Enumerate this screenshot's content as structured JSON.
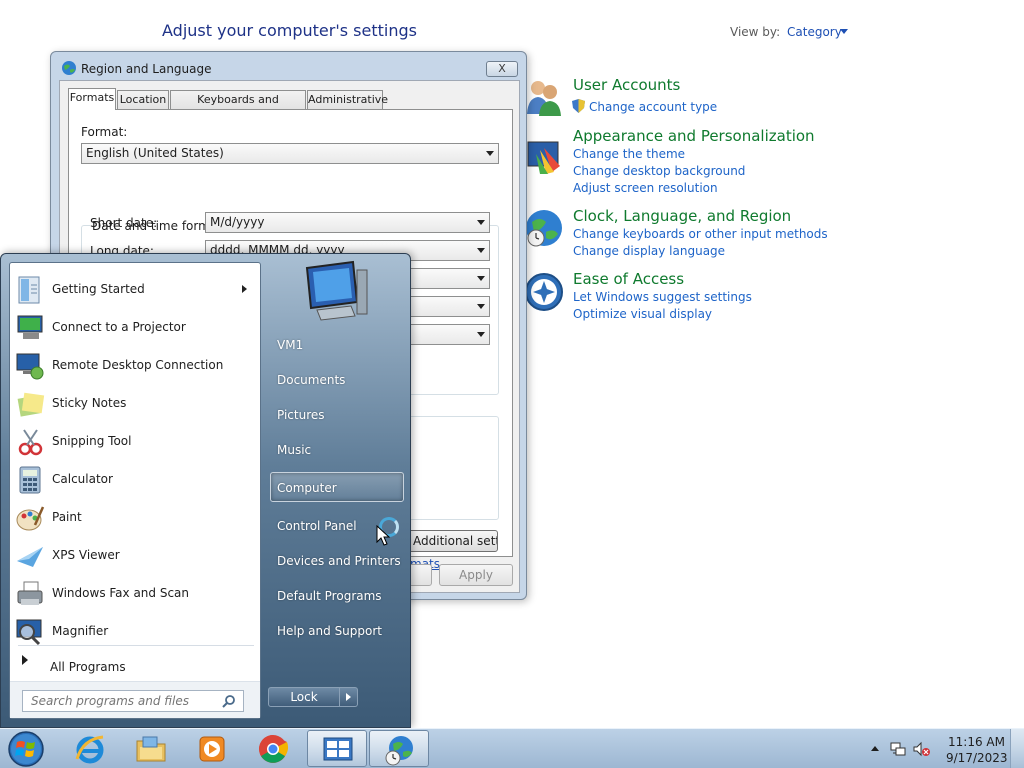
{
  "control_panel": {
    "heading": "Adjust your computer's settings",
    "view_by_label": "View by:",
    "view_by_value": "Category",
    "categories": [
      {
        "title": "User Accounts",
        "links": [
          "Change account type"
        ]
      },
      {
        "title": "Appearance and Personalization",
        "links": [
          "Change the theme",
          "Change desktop background",
          "Adjust screen resolution"
        ]
      },
      {
        "title": "Clock, Language, and Region",
        "links": [
          "Change keyboards or other input methods",
          "Change display language"
        ]
      },
      {
        "title": "Ease of Access",
        "links": [
          "Let Windows suggest settings",
          "Optimize visual display"
        ]
      }
    ]
  },
  "dialog": {
    "title": "Region and Language",
    "close": "X",
    "tabs": [
      "Formats",
      "Location",
      "Keyboards and Languages",
      "Administrative"
    ],
    "format_label": "Format:",
    "format_value": "English (United States)",
    "dt_group_label": "Date and time formats",
    "short_date_label": "Short date:",
    "short_date_value": "M/d/yyyy",
    "long_date_label": "Long date:",
    "long_date_value": "dddd, MMMM dd, yyyy",
    "additional_settings": "Additional settings...",
    "formats_link": "mats",
    "apply": "Apply"
  },
  "start_menu": {
    "programs": [
      "Getting Started",
      "Connect to a Projector",
      "Remote Desktop Connection",
      "Sticky Notes",
      "Snipping Tool",
      "Calculator",
      "Paint",
      "XPS Viewer",
      "Windows Fax and Scan",
      "Magnifier"
    ],
    "all_programs": "All Programs",
    "search_placeholder": "Search programs and files",
    "right_items": [
      "VM1",
      "Documents",
      "Pictures",
      "Music",
      "Computer",
      "Control Panel",
      "Devices and Printers",
      "Default Programs",
      "Help and Support"
    ],
    "lock": "Lock"
  },
  "taskbar": {
    "time": "11:16 AM",
    "date": "9/17/2023"
  },
  "colors": {
    "link": "#1e64c8",
    "category": "#0f7a2e",
    "heading": "#1e3287"
  }
}
